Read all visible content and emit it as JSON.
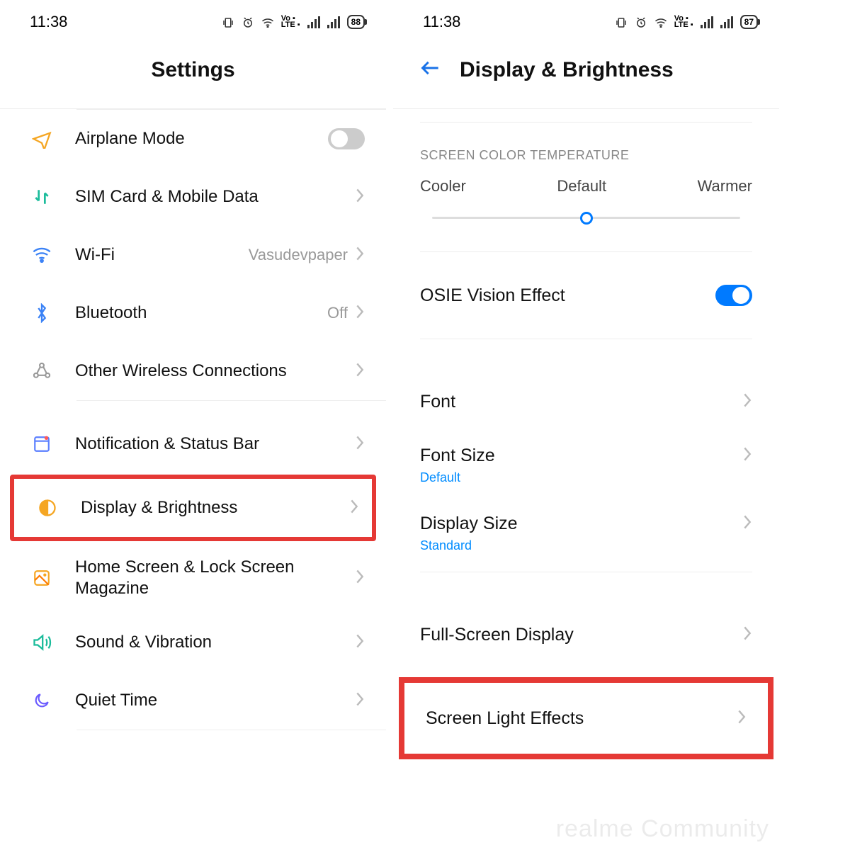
{
  "left": {
    "status": {
      "time": "11:38",
      "battery": "88"
    },
    "title": "Settings",
    "rows": {
      "airplane": {
        "label": "Airplane Mode"
      },
      "sim": {
        "label": "SIM Card & Mobile Data"
      },
      "wifi": {
        "label": "Wi-Fi",
        "value": "Vasudevpaper"
      },
      "bluetooth": {
        "label": "Bluetooth",
        "value": "Off"
      },
      "wireless": {
        "label": "Other Wireless Connections"
      },
      "notif": {
        "label": "Notification & Status Bar"
      },
      "display": {
        "label": "Display & Brightness"
      },
      "home": {
        "label": "Home Screen & Lock Screen Magazine"
      },
      "sound": {
        "label": "Sound & Vibration"
      },
      "quiet": {
        "label": "Quiet Time"
      }
    }
  },
  "right": {
    "status": {
      "time": "11:38",
      "battery": "87"
    },
    "title": "Display & Brightness",
    "section": "SCREEN COLOR TEMPERATURE",
    "temp": {
      "cooler": "Cooler",
      "default": "Default",
      "warmer": "Warmer"
    },
    "rows": {
      "osie": {
        "label": "OSIE Vision Effect"
      },
      "font": {
        "label": "Font"
      },
      "fontsize": {
        "label": "Font Size",
        "sub": "Default"
      },
      "dispsize": {
        "label": "Display Size",
        "sub": "Standard"
      },
      "fullscreen": {
        "label": "Full-Screen Display"
      },
      "lighteff": {
        "label": "Screen Light Effects"
      }
    },
    "watermark": "realme Community"
  }
}
